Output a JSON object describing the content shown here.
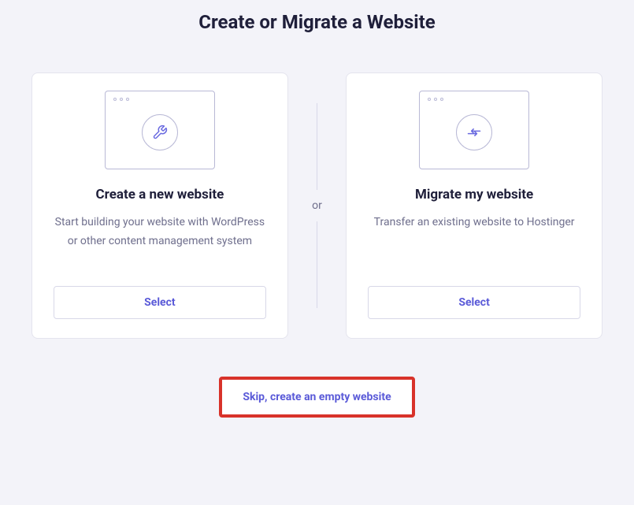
{
  "title": "Create or Migrate a Website",
  "cards": {
    "create": {
      "title": "Create a new website",
      "description": "Start building your website with WordPress or other content management system",
      "button": "Select"
    },
    "migrate": {
      "title": "Migrate my website",
      "description": "Transfer an existing website to Hostinger",
      "button": "Select"
    }
  },
  "divider": "or",
  "skip": "Skip, create an empty website"
}
